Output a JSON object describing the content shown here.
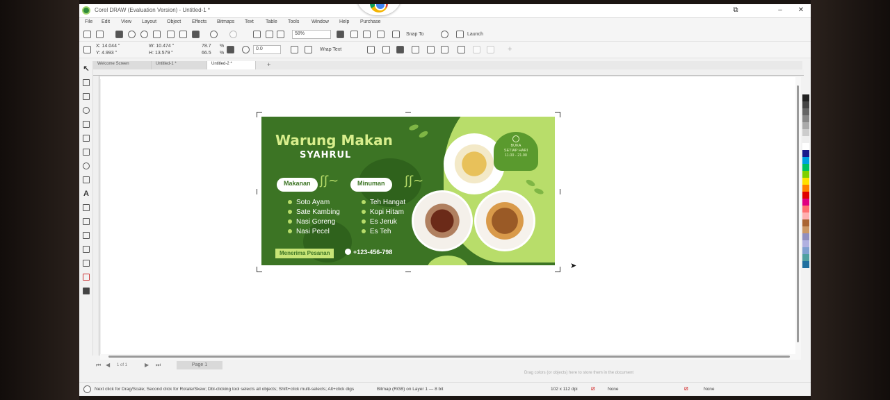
{
  "window": {
    "title": "Corel DRAW (Evaluation Version) - Untitled-1 *",
    "restore_glyph": "⧉",
    "minimize_glyph": "–",
    "close_glyph": "✕"
  },
  "menubar": [
    "File",
    "Edit",
    "View",
    "Layout",
    "Object",
    "Effects",
    "Bitmaps",
    "Text",
    "Table",
    "Tools",
    "Window",
    "Help",
    "Purchase"
  ],
  "toolbar": {
    "zoom": "58%",
    "snap": "Snap To",
    "launch": "Launch",
    "x": "X: 14.044 \"",
    "y": "Y: 4.993 \"",
    "w": "W: 10.474 \"",
    "h": "H: 13.579 \"",
    "scale_w": "78.7",
    "scale_h": "66.5",
    "pct": "%",
    "angle": "0.0",
    "wrap": "Wrap Text"
  },
  "tabs": [
    "Welcome Screen",
    "Untitled-1 *",
    "Untitled-2 *"
  ],
  "tab_add": "+",
  "pagebar": {
    "page": "1 of 1",
    "page_tab": "Page 1",
    "hint": "Drag colors (or objects) here to store them in the document"
  },
  "status": {
    "left": "Next click for Drag/Scale; Second click for Rotate/Skew; Dbl-clicking tool selects all objects; Shift+click multi-selects; Alt+click digs",
    "middle": "Bitmap (RGB) on Layer 1 — 8 bit",
    "coords": "102 x 112 dpi",
    "fill": "None",
    "outline": "None"
  },
  "design": {
    "title": "Warung Makan",
    "subtitle": "SYAHRUL",
    "food_label": "Makanan",
    "drink_label": "Minuman",
    "foods": [
      "Soto Ayam",
      "Sate Kambing",
      "Nasi Goreng",
      "Nasi Pecel"
    ],
    "drinks": [
      "Teh Hangat",
      "Kopi Hitam",
      "Es Jeruk",
      "Es Teh"
    ],
    "order": "Menerima Pesanan",
    "phone": "+123-456-798",
    "open_title": "BUKA",
    "open_days": "SETIAP HARI",
    "open_hours": "11.00 - 21.00"
  },
  "colors": {
    "banner_green": "#3c7424",
    "lime": "#b8dd6a",
    "accent_palette": [
      "#222222",
      "#444444",
      "#666666",
      "#888888",
      "#aaaaaa",
      "#cccccc",
      "#eeeeee",
      "#ffffff",
      "#1a1a8c",
      "#00a0e0",
      "#00c060",
      "#80d000",
      "#ffe000",
      "#ff8000",
      "#e00000",
      "#e00080",
      "#ff7070",
      "#ffb0b0",
      "#aa6633",
      "#cc9966",
      "#9090c0",
      "#b0b0e0",
      "#7fa0d0",
      "#50a0a0",
      "#2070a0"
    ]
  }
}
